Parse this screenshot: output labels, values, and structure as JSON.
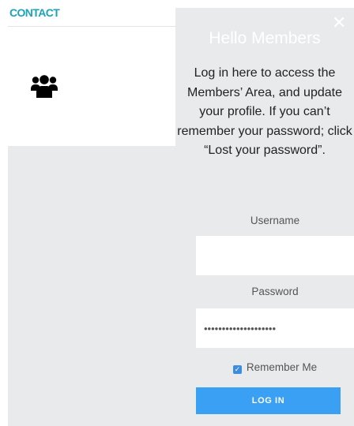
{
  "nav": {
    "contact_label": "CONTACT"
  },
  "icons": {
    "members": "users-group-icon",
    "close": "close-icon",
    "check": "checkmark-icon"
  },
  "panel": {
    "title": "Hello Members",
    "intro": "Log in here to access the Members’ Area, and update your profile. If you can’t remember your password; click “Lost your password”.",
    "username_label": "Username",
    "username_value": "",
    "password_label": "Password",
    "password_value": "••••••••••••••••••••",
    "remember_label": "Remember Me",
    "remember_checked": true,
    "login_label": "LOG IN"
  },
  "colors": {
    "accent_teal": "#1ba3b7",
    "panel_bg": "#e9eaec",
    "button_blue": "#3aa0f3",
    "checkbox_blue": "#3c8dde"
  }
}
